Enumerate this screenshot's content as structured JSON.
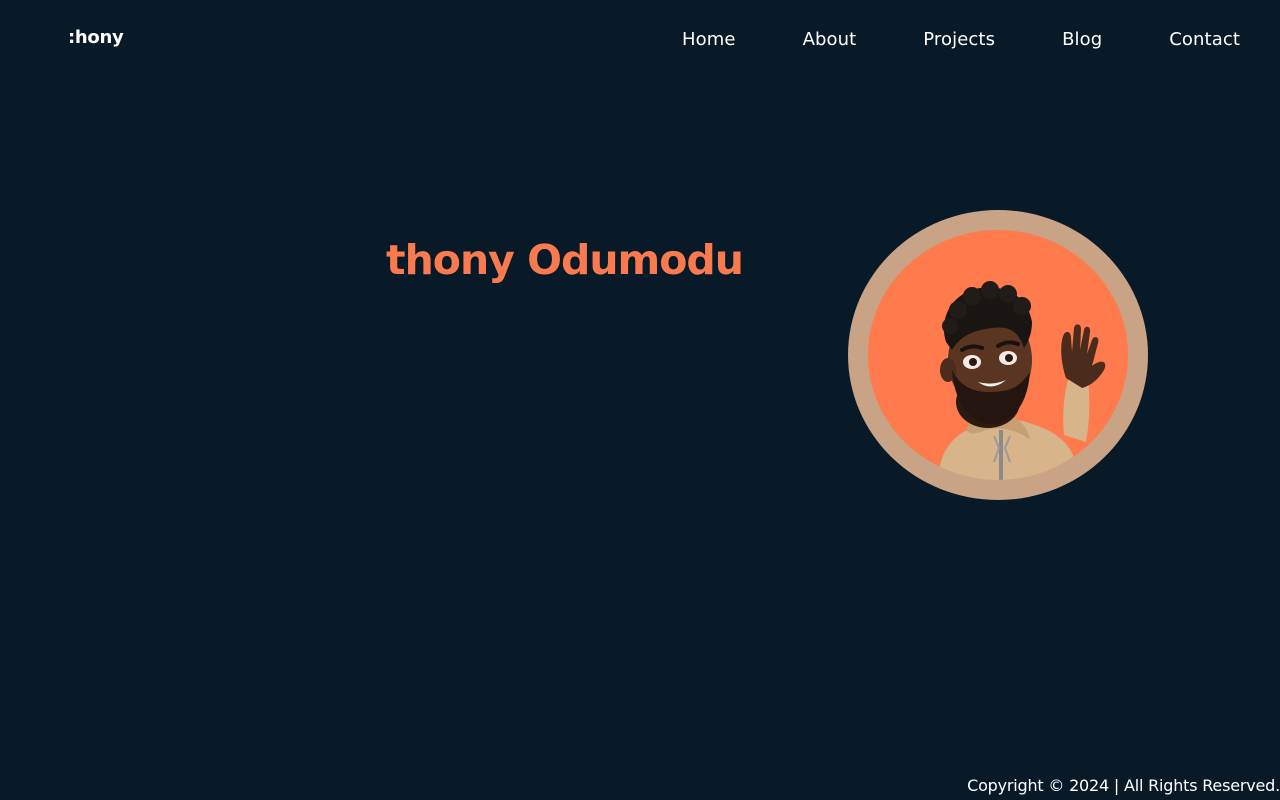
{
  "header": {
    "logo_text": ":hony",
    "nav": [
      {
        "label": "Home"
      },
      {
        "label": "About"
      },
      {
        "label": "Projects"
      },
      {
        "label": "Blog"
      },
      {
        "label": "Contact"
      }
    ]
  },
  "hero": {
    "title": "thony Odumodu",
    "avatar_icon": "memoji-waving-avatar",
    "colors": {
      "title": "#fa7a4f",
      "avatar_ring": "#c9a386",
      "avatar_background": "#ff7a4c",
      "page_background": "#081a27"
    }
  },
  "footer": {
    "copyright": "Copyright © 2024 | All Rights Reserved."
  }
}
